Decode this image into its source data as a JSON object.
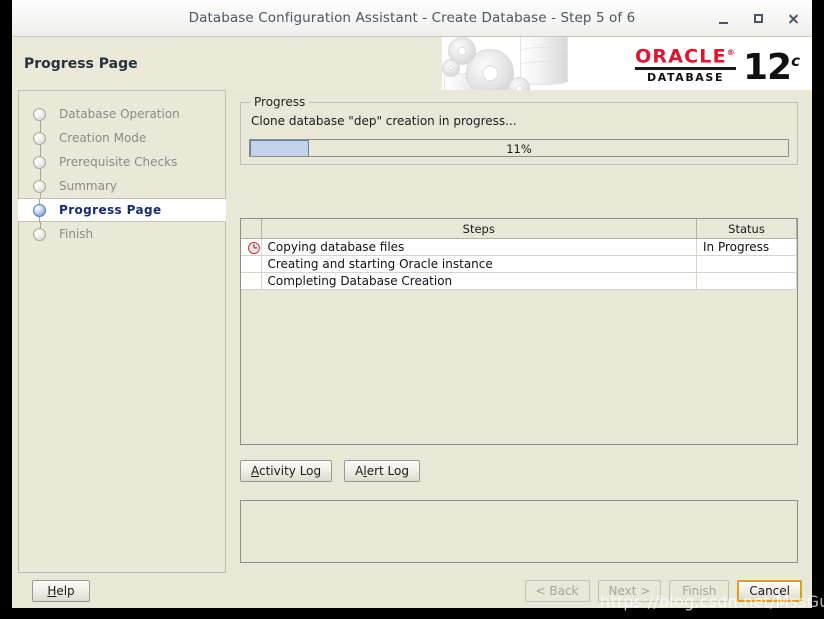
{
  "window": {
    "title": "Database Configuration Assistant - Create Database - Step 5 of 6",
    "minimize_label": "Minimize",
    "maximize_label": "Maximize",
    "close_label": "Close"
  },
  "banner": {
    "title": "Progress Page",
    "oracle_word": "ORACLE",
    "oracle_trademark": "®",
    "oracle_product": "DATABASE",
    "oracle_version": "12",
    "oracle_version_suffix": "c"
  },
  "sidebar": {
    "items": [
      {
        "label": "Database Operation",
        "state": "done"
      },
      {
        "label": "Creation Mode",
        "state": "done"
      },
      {
        "label": "Prerequisite Checks",
        "state": "done"
      },
      {
        "label": "Summary",
        "state": "done"
      },
      {
        "label": "Progress Page",
        "state": "active"
      },
      {
        "label": "Finish",
        "state": "pending"
      }
    ]
  },
  "progress_group": {
    "legend": "Progress",
    "status_text": "Clone database \"dep\" creation in progress...",
    "percent": 11,
    "percent_label": "11%",
    "fill_color": "#c3d3ea"
  },
  "steps_table": {
    "columns": [
      "",
      "Steps",
      "Status"
    ],
    "rows": [
      {
        "icon": "clock-icon",
        "step": "Copying database files",
        "status": "In Progress"
      },
      {
        "icon": "",
        "step": "Creating and starting Oracle instance",
        "status": ""
      },
      {
        "icon": "",
        "step": "Completing Database Creation",
        "status": ""
      }
    ]
  },
  "log_buttons": {
    "activity_log": "Activity Log",
    "activity_log_mnemonic": "A",
    "activity_log_rest": "ctivity Log",
    "alert_log_pre": "A",
    "alert_log_mnemonic": "l",
    "alert_log_rest": "ert Log"
  },
  "message_panel": {
    "text": ""
  },
  "footer": {
    "help_mnemonic": "H",
    "help_rest": "elp",
    "back_label": "< Back",
    "back_mnemonic": "B",
    "next_label": "Next >",
    "next_mnemonic": "N",
    "finish_label": "Finish",
    "finish_mnemonic": "F",
    "cancel_label": "Cancel",
    "cancel_mnemonic": "C"
  },
  "watermark": {
    "text": "https://blog.csdn.net/MssGuo"
  }
}
